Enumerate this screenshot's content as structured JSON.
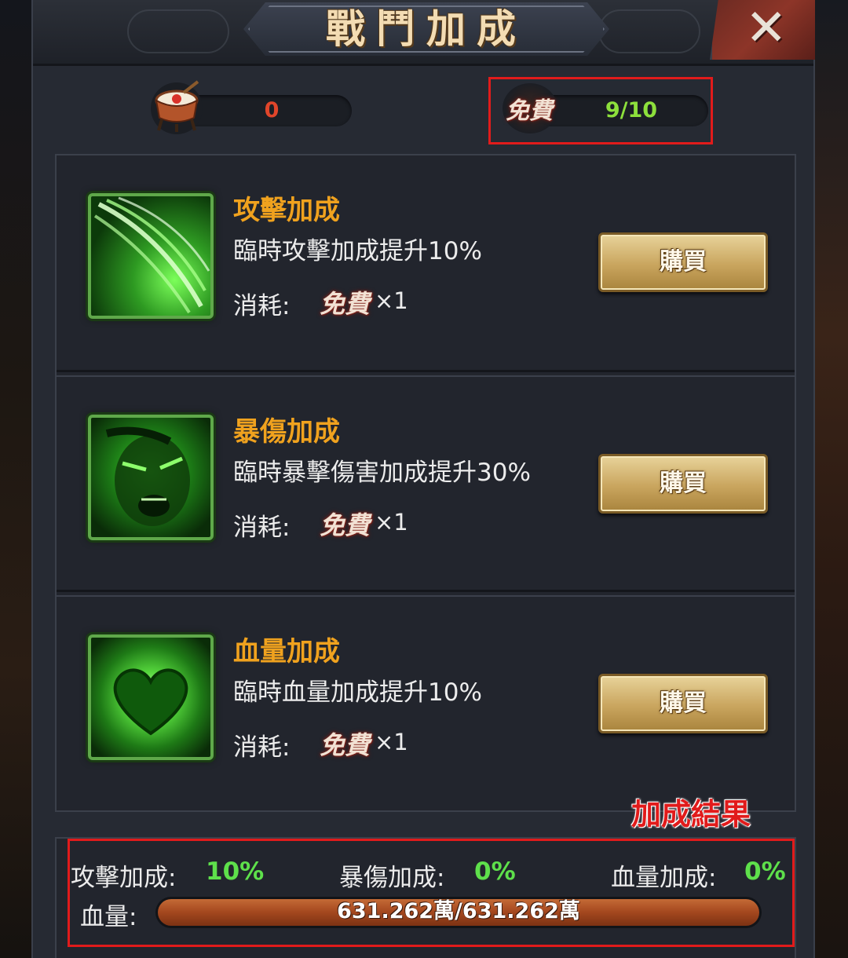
{
  "header": {
    "title": "戰鬥加成",
    "close_label": "✕"
  },
  "resources": {
    "drum_count": "0",
    "free_stamp": "免費",
    "free_count": "9/10"
  },
  "boosts": [
    {
      "title": "攻擊加成",
      "description": "臨時攻擊加成提升10%",
      "cost_label": "消耗:",
      "cost_stamp": "免費",
      "cost_qty": "×1",
      "buy_label": "購買",
      "icon": "slash-icon"
    },
    {
      "title": "暴傷加成",
      "description": "臨時暴擊傷害加成提升30%",
      "cost_label": "消耗:",
      "cost_stamp": "免費",
      "cost_qty": "×1",
      "buy_label": "購買",
      "icon": "roar-face-icon"
    },
    {
      "title": "血量加成",
      "description": "臨時血量加成提升10%",
      "cost_label": "消耗:",
      "cost_stamp": "免費",
      "cost_qty": "×1",
      "buy_label": "購買",
      "icon": "heart-icon"
    }
  ],
  "result": {
    "annotation": "加成結果",
    "attack_label": "攻擊加成:",
    "attack_value": "10%",
    "crit_label": "暴傷加成:",
    "crit_value": "0%",
    "hp_bonus_label": "血量加成:",
    "hp_bonus_value": "0%",
    "hp_label": "血量:",
    "hp_text": "631.262萬/631.262萬",
    "hp_fill_fraction": 1.0
  },
  "colors": {
    "accent_orange": "#f0a21e",
    "value_green": "#5ee04b",
    "highlight_red": "#e11b1b",
    "drum_count_red": "#e0452a"
  }
}
